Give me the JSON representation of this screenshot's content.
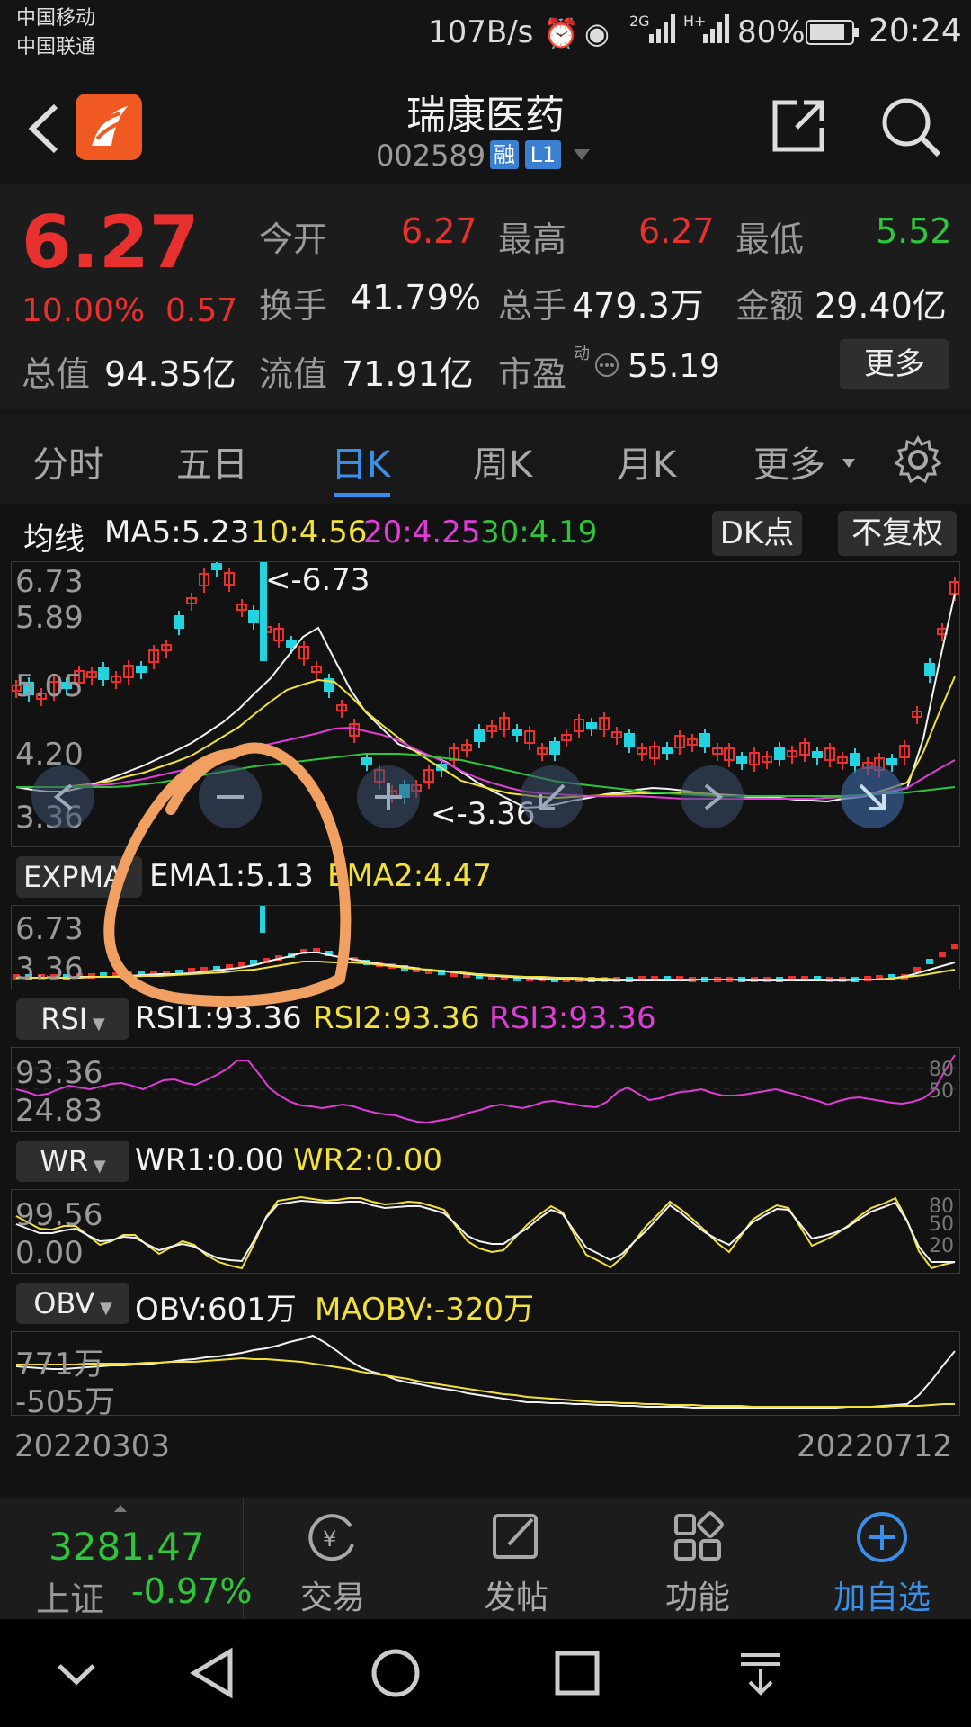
{
  "status": {
    "carrier1": "中国移动",
    "carrier2": "中国联通",
    "speed": "107B/s",
    "net1": "2G",
    "net2": "H+",
    "battery": "80%",
    "time": "20:24"
  },
  "header": {
    "title": "瑞康医药",
    "code": "002589",
    "badge_margin": "融",
    "badge_level": "L1"
  },
  "quote": {
    "price": "6.27",
    "pct": "10.00%",
    "change": "0.57",
    "open_label": "今开",
    "open": "6.27",
    "high_label": "最高",
    "high": "6.27",
    "low_label": "最低",
    "low": "5.52",
    "turnover_label": "换手",
    "turnover": "41.79%",
    "volume_label": "总手",
    "volume": "479.3万",
    "amount_label": "金额",
    "amount": "29.40亿",
    "mktcap_label": "总值",
    "mktcap": "94.35亿",
    "float_label": "流值",
    "float": "71.91亿",
    "pe_label": "市盈",
    "pe_sup": "动",
    "pe": "55.19",
    "more": "更多"
  },
  "tabs": [
    "分时",
    "五日",
    "日K",
    "周K",
    "月K",
    "更多"
  ],
  "active_tab": "日K",
  "ma": {
    "label": "均线",
    "ma5": "MA5:5.23",
    "ma10": "10:4.56",
    "ma20": "20:4.25",
    "ma30": "30:4.19",
    "dk": "DK点",
    "fq": "不复权"
  },
  "kline": {
    "ymax": "6.73",
    "y2": "5.89",
    "y3": "5.05",
    "y4": "4.20",
    "ymin": "3.36",
    "hi_mark": "<-6.73",
    "lo_mark": "<-3.36"
  },
  "expma": {
    "name": "EXPMA",
    "ema1": "EMA1:5.13",
    "ema2": "EMA2:4.47",
    "ymax": "6.73",
    "ymin": "3.36"
  },
  "rsi": {
    "name": "RSI",
    "rsi1": "RSI1:93.36",
    "rsi2": "RSI2:93.36",
    "rsi3": "RSI3:93.36",
    "ymax": "93.36",
    "ymin": "24.83",
    "r80": "80",
    "r50": "50"
  },
  "wr": {
    "name": "WR",
    "wr1": "WR1:0.00",
    "wr2": "WR2:0.00",
    "ymax": "99.56",
    "ymin": "0.00",
    "r80": "80",
    "r50": "50",
    "r20": "20"
  },
  "obv": {
    "name": "OBV",
    "obv": "OBV:601万",
    "maobv": "MAOBV:-320万",
    "ymax": "771万",
    "ymin": "-505万"
  },
  "dates": {
    "start": "20220303",
    "end": "20220712"
  },
  "bottom": {
    "index_value": "3281.47",
    "index_name": "上证",
    "index_pct": "-0.97%",
    "trade": "交易",
    "post": "发帖",
    "func": "功能",
    "add": "加自选"
  },
  "colors": {
    "up": "#e8302e",
    "down": "#23d3e0",
    "ma5": "#f2f2f2",
    "ma10": "#f1e13a",
    "ma20": "#e03cd8",
    "ma30": "#2fc63c",
    "accent": "#3a8fe8",
    "annotation": "#f0a060"
  }
}
